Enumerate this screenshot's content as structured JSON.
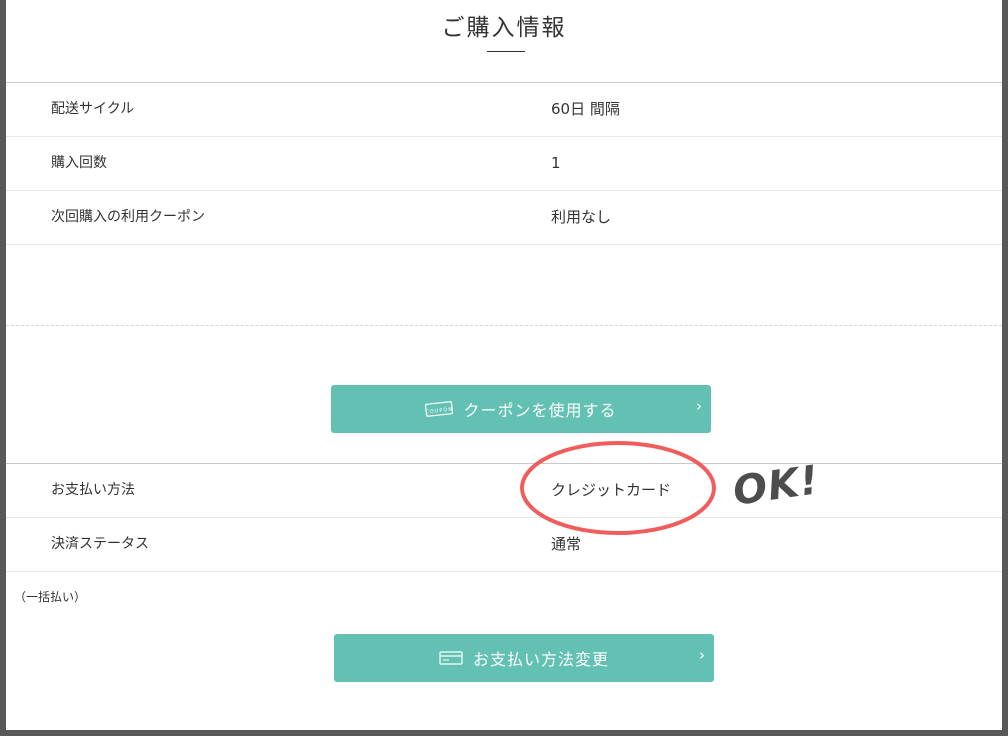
{
  "section_title": "ご購入情報",
  "rows_top": [
    {
      "label": "配送サイクル",
      "value": "60日 間隔"
    },
    {
      "label": "購入回数",
      "value": "1"
    },
    {
      "label": "次回購入の利用クーポン",
      "value": "利用なし"
    }
  ],
  "coupon_button": {
    "label": "クーポンを使用する",
    "icon_text": "COUPON"
  },
  "rows_payment": [
    {
      "label": "お支払い方法",
      "value": "クレジットカード"
    },
    {
      "label": "決済ステータス",
      "value": "通常"
    }
  ],
  "payment_note": "（一括払い）",
  "change_payment_button": {
    "label": "お支払い方法変更"
  },
  "annotation": {
    "text": "OK!",
    "circle_color": "#ef5d5d"
  },
  "colors": {
    "accent": "#62c1b3",
    "annotation_red": "#ef5d5d",
    "frame": "#595959"
  }
}
